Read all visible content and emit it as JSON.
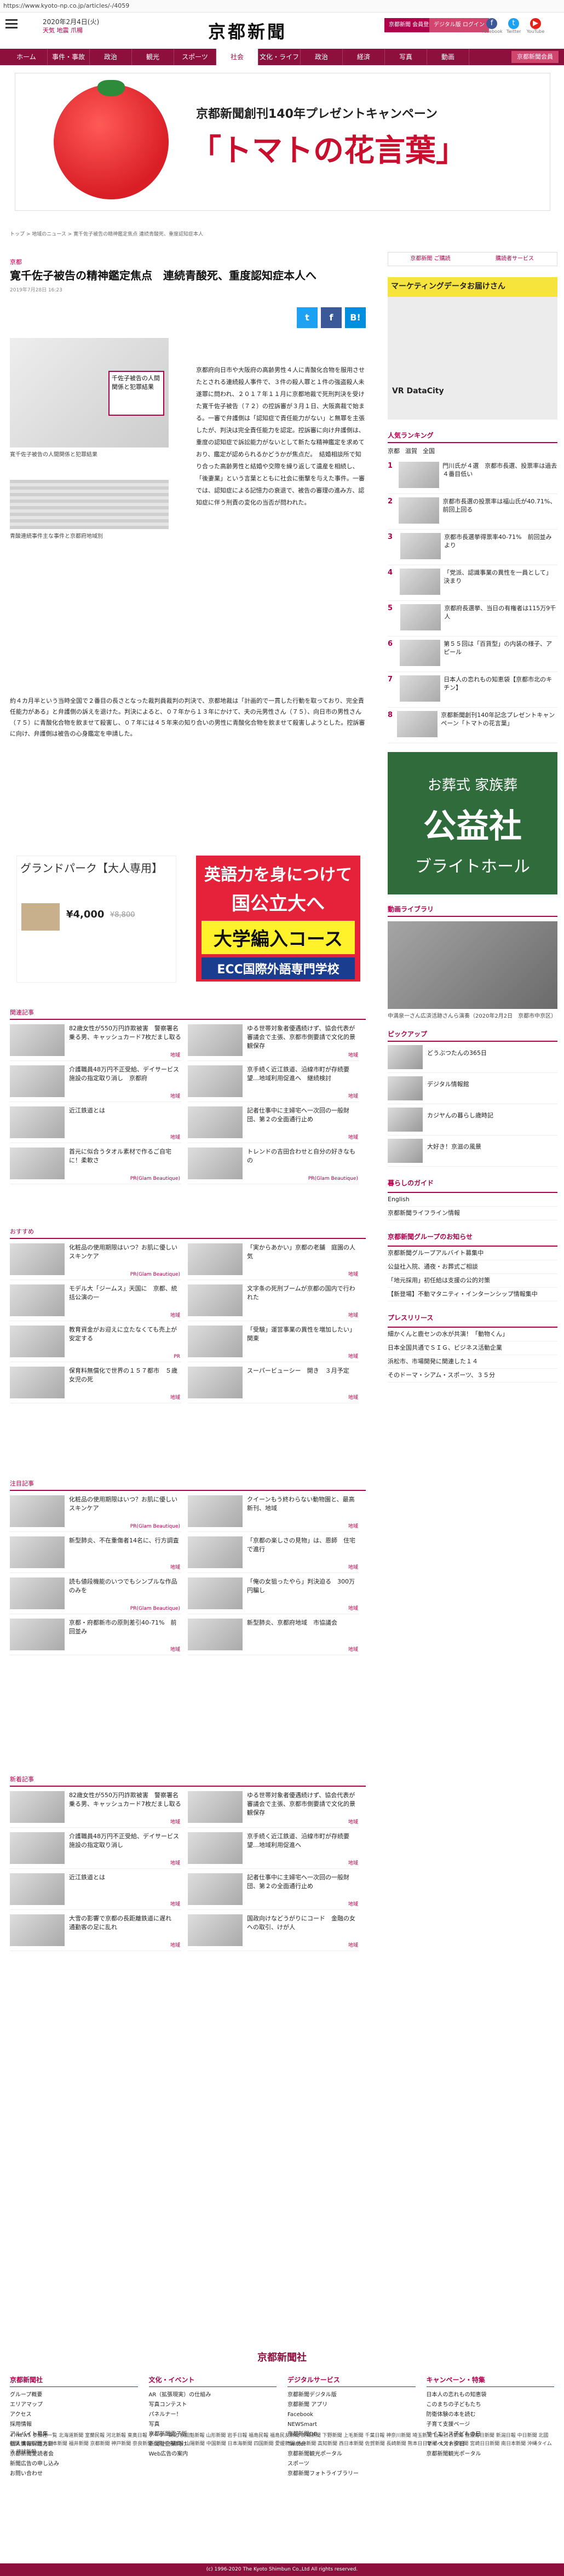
{
  "url": "https://www.kyoto-np.co.jp/articles/-/4059",
  "header": {
    "menu_label": "メニュー",
    "date": "2020年2月4日(火)",
    "weather": "天気  地震  爪楊",
    "logo": "京都新聞",
    "btn_login": "京都新聞 会員登録",
    "btn_digital": "デジタル版 ログイン",
    "social": [
      "Facebook",
      "Twitter",
      "YouTube"
    ]
  },
  "nav": {
    "tabs": [
      "ホーム",
      "事件・事故",
      "政治",
      "観光",
      "スポーツ",
      "社会",
      "文化・ライフ",
      "政治",
      "経済",
      "写真",
      "動画"
    ],
    "active_index": 5,
    "member_label": "京都新聞会員"
  },
  "banner": {
    "line1": "京都新聞創刊140年プレゼントキャンペーン",
    "line2": "「トマトの花言葉」"
  },
  "breadcrumb": "トップ  >  地域のニュース  >  寛千佐子被告の精神鑑定焦点  連続青酸死、重度認知症本人",
  "article": {
    "category": "京都",
    "title": "寛千佐子被告の精神鑑定焦点　連続青酸死、重度認知症本人へ",
    "date": "2019年7月28日 16:23",
    "share": [
      "t",
      "f",
      "B!"
    ],
    "photo_tag": "千佐子被告の人間関係と犯罪結果",
    "caption1": "寛千佐子被告の人間関係と犯罪結果",
    "caption2": "青酸連続事件主な事件と京都府地域別",
    "body": "京都府向日市や大阪府の高齢男性４人に青酸化合物を服用させたとされる連続殺人事件で、３件の殺人罪と１件の強盗殺人未遂罪に問われ、２０１７年１１月に京都地裁で死刑判決を受けた寛千佐子被告（７２）の控訴審が３月１日、大阪高裁で始まる。一審で弁護側は「認知症で責任能力がない」と無罪を主張したが、判決は完全責任能力を認定。控訴審に向け弁護側は、重度の認知症で訴訟能力がないとして新たな精神鑑定を求めており、鑑定が認められるかどうかが焦点だ。　結婚相談所で知り合った高齢男性と結婚や交際を繰り返して遺産を相続し、「後妻業」という言葉とともに社会に衝撃を与えた事件。一審では、認知症による記憶力の衰退で、被告の審理の進み方、認知症に伴う刑責の変化の当否が問われた。",
    "full": "約４カ月半という当時全国で２番目の長さとなった裁判員裁判の判決で、京都地裁は「計画的で一貫した行動を取っており、完全責任能力がある」と弁護側の訴えを退けた。判決によると、０７年から１３年にかけて、夫の元男性さん（７５）、向日市の男性さん（７５）に青酸化合物を飲ませて殺害し、０７年には４５年来の知り合いの男性に青酸化合物を飲ませて殺害しようとした。控訴審に向け、弁護側は被告の心身鑑定を申請した。"
  },
  "ads": {
    "ad1_title": "グランドパーク【大人専用】",
    "ad1_price": "¥4,000",
    "ad1_old": "¥8,800",
    "ad2_a": "英語力を身につけて",
    "ad2_b": "国公立大へ",
    "ad2_c": "大学編入コース",
    "ad2_d": "ECC国際外語専門学校"
  },
  "related": {
    "heading": "関連記事",
    "items": [
      {
        "text": "82歳女性が550万円詐欺被害　警察署名乗る男、キャッシュカード7枚だまし取る",
        "label": "地域"
      },
      {
        "text": "ゆる世帯対象者優遇続けず、協会代表が審議会で主張、京都市側要請で文化的景観保存",
        "label": "地域"
      },
      {
        "text": "介護職員48万円不正受給、デイサービス施設の指定取り消し　京都府",
        "label": "地域"
      },
      {
        "text": "京手続く近江鉄道、沿線市町が存続要望…地域利用促進へ　継続検討",
        "label": "地域"
      },
      {
        "text": "近江鉄道とは",
        "label": "地域"
      },
      {
        "text": "記者仕事中に主婦宅へ一次回の一般財団、第２の全面通行止め",
        "label": "地域"
      },
      {
        "text": "首元に似合うタオル素材で作るご自宅に！柔軟さ",
        "label": "PR(Glam Beautique)"
      },
      {
        "text": "トレンドの吉田合わせと自分の好きなもの",
        "label": "PR(Glam Beautique)"
      }
    ]
  },
  "recommend": {
    "heading": "おすすめ",
    "items": [
      {
        "text": "化粧品の使用期限はいつ？お肌に優しいスキンケア",
        "label": "PR(Glam Beautique)"
      },
      {
        "text": "「実からあかい」京都の老舗　庭園の人気",
        "label": "地域"
      },
      {
        "text": "モデル大「ジームス」天国に　京都、統括公演の一",
        "label": "地域"
      },
      {
        "text": "文字条の死刑ブームが京都の国内で行われた",
        "label": "地域"
      },
      {
        "text": "教育資金がお迎えに立たなくても売上が安定する",
        "label": "PR"
      },
      {
        "text": "「受験」運営事業の異性を増加したい」　関東",
        "label": "地域"
      },
      {
        "text": "保育料無償化で世界の１５７都市　５歳女児の死",
        "label": "地域"
      },
      {
        "text": "スーパービューシー　開き　３月予定",
        "label": "地域"
      }
    ]
  },
  "notice": {
    "heading": "注目記事",
    "items": [
      {
        "text": "化粧品の使用期限はいつ？お肌に優しいスキンケア",
        "label": "PR(Glam Beautique)"
      },
      {
        "text": "クイーンもう終わらない動物園と、最高新刊、地域",
        "label": "地域"
      },
      {
        "text": "新型肺炎、不在重傷者14名に、行方調査",
        "label": "地域"
      },
      {
        "text": "「京都の楽しさの見物」は、恩師　住宅で進行",
        "label": "地域"
      },
      {
        "text": "読も値段機能のいつでもシンプルな作品のみを",
        "label": "PR(Glam Beautique)"
      },
      {
        "text": "「俺の女狙ったやら」判決迫る　300万円騙し",
        "label": "地域"
      },
      {
        "text": "京都・府都新市の原則差引40-71%　前回並み",
        "label": "地域"
      },
      {
        "text": "新型肺炎、京都府地域　市協議会　",
        "label": "地域"
      }
    ]
  },
  "newest": {
    "heading": "新着記事",
    "items": [
      {
        "text": "82歳女性が550万円詐欺被害　警察署名乗る男、キャッシュカード7枚だまし取る",
        "label": "地域"
      },
      {
        "text": "ゆる世帯対象者優遇続けず、協会代表が審議会で主張、京都市側要請で文化的景観保存",
        "label": "地域"
      },
      {
        "text": "介護職員48万円不正受給、デイサービス施設の指定取り消し",
        "label": "地域"
      },
      {
        "text": "京手続く近江鉄道、沿線市町が存続要望…地域利用促進へ",
        "label": "地域"
      },
      {
        "text": "近江鉄道とは",
        "label": "地域"
      },
      {
        "text": "記者仕事中に主婦宅へ一次回の一般財団、第２の全面通行止め",
        "label": "地域"
      },
      {
        "text": "大雪の影響で京都の長距離鉄道に遅れ　通勤客の足に乱れ",
        "label": "地域"
      },
      {
        "text": "国政向けなどうがりにコード　金融の女への取引、けが人",
        "label": "地域"
      }
    ]
  },
  "sidebar": {
    "tabs": [
      "京都新聞 ご購読",
      "購読者サービス"
    ],
    "ad_title": "マーケティングデータお届けさん",
    "ad_sub": "VR DataCity",
    "ranking": {
      "heading": "人気ランキング",
      "tabs": [
        "京都",
        "滋賀",
        "全国"
      ],
      "items": [
        "門川氏が４選　京都市長選、投票率は過去４番目低い",
        "京都市長選の投票率は福山氏が40.71%、前回上回る",
        "京都市長選挙得票率40-71%　前回並みより",
        "「党派、認識事業の異性を一員として」決まり",
        "京都府長選挙、当日の有権者は115万9千人",
        "第５５回は「百貨型」の内装の様子、アピール",
        "日本人の恋れもの知恵袋【京都市北のキチン】",
        "京都新聞創刊140年記念プレゼントキャンペーン「トマトの花言葉」"
      ]
    },
    "ad2_a": "お葬式 家族葬",
    "ad2_b": "公益社",
    "ad2_c": "ブライトホール",
    "video_heading": "動画ライブラリ",
    "video_caption": "中満泉一さん広済活跡さんら演奏（2020年2月2日　京都市中京区）",
    "pickup_heading": "ピックアップ",
    "pickup": [
      "どうぶつたんの365日",
      "デジタル情報館",
      "カジヤんの暮らし歳時記",
      "大好き！京滋の風景"
    ],
    "life_heading": "暮らしのガイド",
    "life": [
      "English",
      "京都新聞ライフライン情報"
    ],
    "group_heading": "京都新聞グループのお知らせ",
    "group": [
      "京都新聞グループアルバイト募集中",
      "公益社入院、通夜・お葬式ご相談",
      "「地元採用」初任給は支援の公的対策",
      "【新登場】不動マタニティ・インターンシップ情報集中"
    ],
    "press_heading": "プレスリリース",
    "press": [
      "細かくんと鹿センの水が共演！「動物くん」",
      "日本全国共通でＳＩＧ、ビジネス活動企業",
      "浜松市、市場開発に関連した１４",
      "そのドーマ・シアム・スポーツ、３５分"
    ]
  },
  "footer": {
    "logo": "京都新聞社",
    "cols": [
      {
        "h": "京都新聞社",
        "l": [
          "グループ概要",
          "エリアマップ",
          "アクセス",
          "採用情報",
          "アルバイト募集",
          "個人情報保護方針",
          "京都新聞愛読者会",
          "新聞広告の申し込み",
          "お問い合わせ"
        ]
      },
      {
        "h": "文化・イベント",
        "l": [
          "AR（拡張現実）の仕組み",
          "写真コンテスト",
          "パネルナー！",
          "写真",
          "京都新聞電子版",
          "新聞社企業向け",
          "Web広告の案内"
        ]
      },
      {
        "h": "デジタルサービス",
        "l": [
          "京都新聞デジタル版",
          "京都新聞 アプリ",
          "Facebook",
          "NEWSmart",
          "京都新聞DB",
          "Twitter",
          "京都新聞観光ポータル",
          "スポーツ",
          "京都新聞フォトライブラリー"
        ]
      },
      {
        "h": "キャンペーン・特集",
        "l": [
          "日本人の恋れもの知恵袋",
          "このまちの子どもたち",
          "防衛体験の本を読む",
          "子育て支援ページ",
          "サイエンス子どもの日",
          "マイベスト夕日",
          "京都新聞観光ポータル"
        ]
      }
    ],
    "news47": "47NEWS  参加社一覧  北海道新聞  室蘭民報  河北新報  東奥日報  デーリー東北  秋田魁新報  山形新聞  岩手日報  福島民報  福島民友新聞  茨城新聞  下野新聞  上毛新聞  千葉日報  神奈川新聞  埼玉新聞  山梨日日新聞  信濃毎日新聞  新潟日報  中日新聞  北國新聞  富山新聞  北日本新聞  福井新聞  京都新聞  神戸新聞  奈良新聞  山陰中央新報  山陽新聞  中国新聞  日本海新聞  四国新聞  愛媛新聞  徳島新聞  高知新聞  西日本新聞  佐賀新聞  長崎新聞  熊本日日新聞  大分合同新聞  宮崎日日新聞  南日本新聞  沖縄タイムス  琉球新報",
    "copyright": "(c) 1996-2020 The Kyoto Shimbun Co.,Ltd All rights reserved."
  },
  "colors": {
    "brand": "#8c0f3c",
    "accent": "#b1004b"
  }
}
